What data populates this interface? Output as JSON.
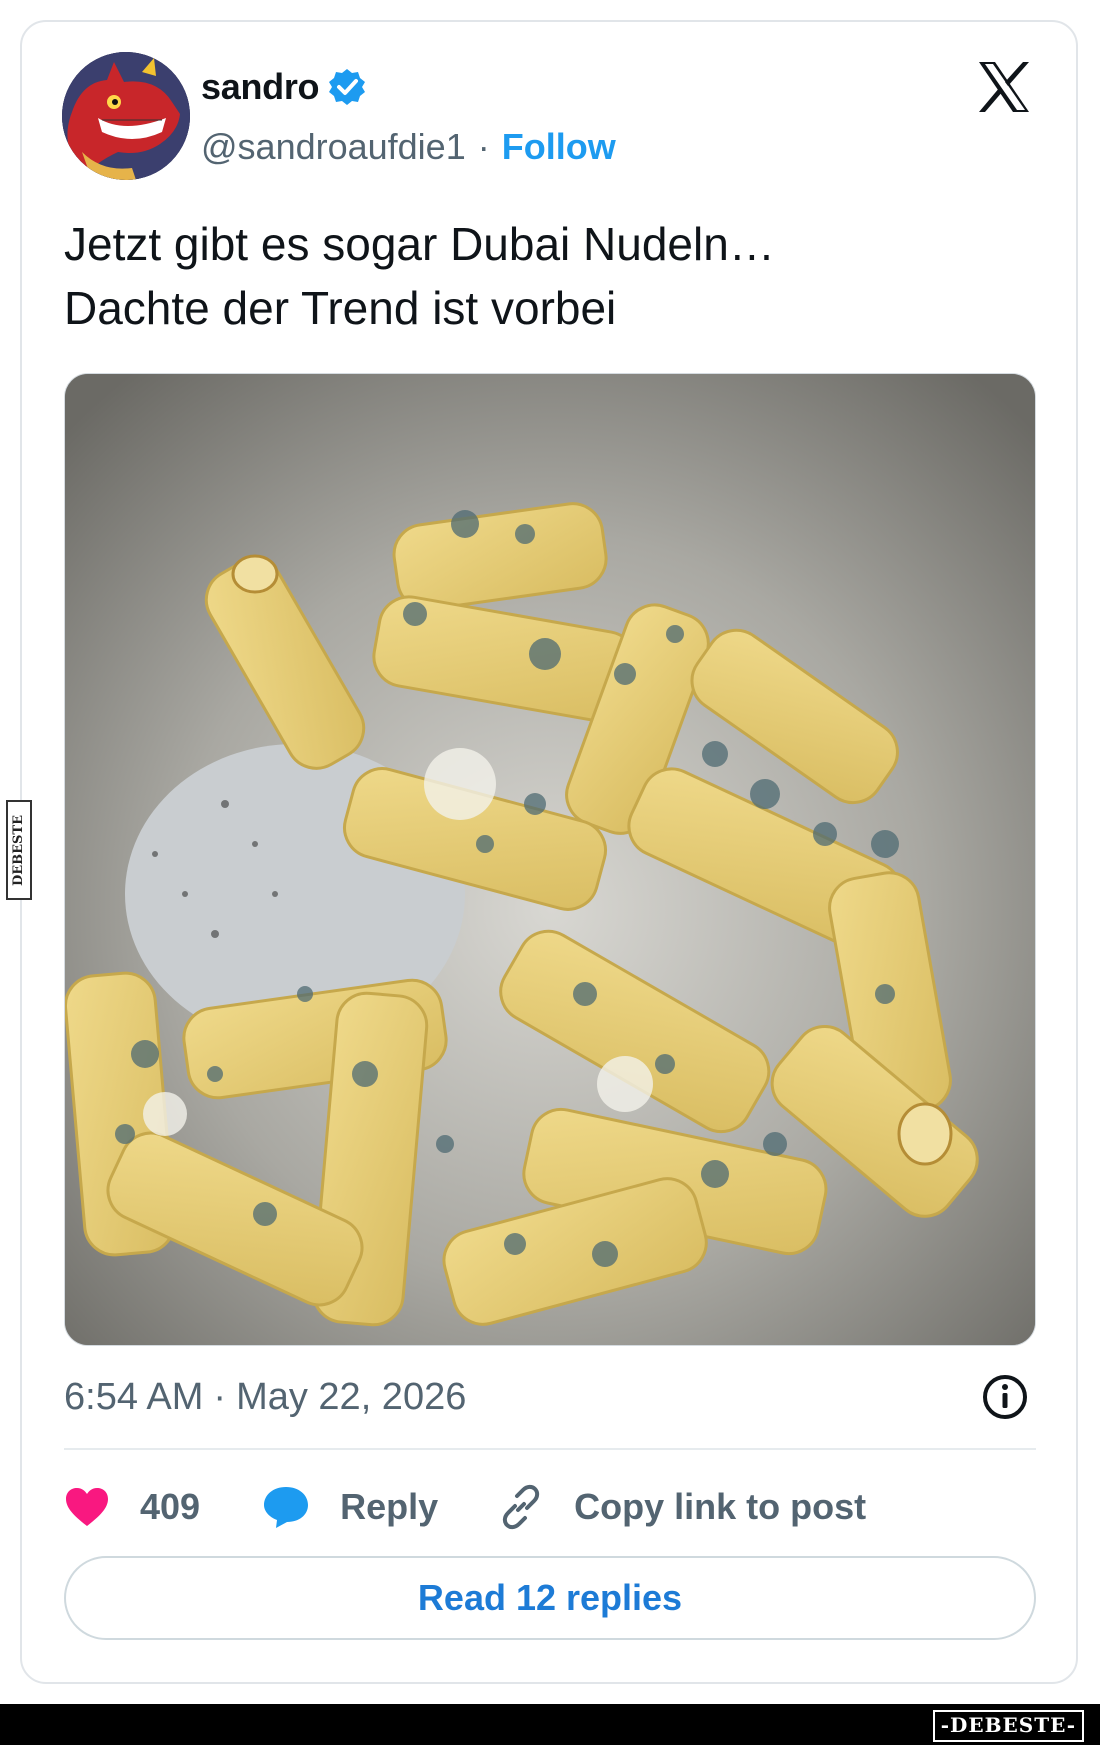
{
  "tweet": {
    "display_name": "sandro",
    "handle": "@sandroaufdie1",
    "separator": "·",
    "follow_label": "Follow",
    "text_lines": [
      "Jetzt gibt es sogar Dubai Nudeln…",
      "Dachte der Trend ist vorbei"
    ],
    "time": "6:54 AM",
    "date": "May 22, 2026",
    "like_count": "409",
    "reply_label": "Reply",
    "copy_link_label": "Copy link to post",
    "read_replies_label": "Read 12 replies"
  },
  "icons": {
    "verified": "verified-badge-icon",
    "platform": "x-logo-icon",
    "info": "info-icon",
    "like": "heart-icon",
    "reply": "speech-bubble-icon",
    "copy_link": "link-icon"
  },
  "watermark": {
    "side_text": "DEBESTE",
    "bottom_text": "-DEBESTE-"
  },
  "colors": {
    "accent": "#1d9bf0",
    "like": "#f91880",
    "text_secondary": "#536471",
    "text_primary": "#0f1419"
  }
}
